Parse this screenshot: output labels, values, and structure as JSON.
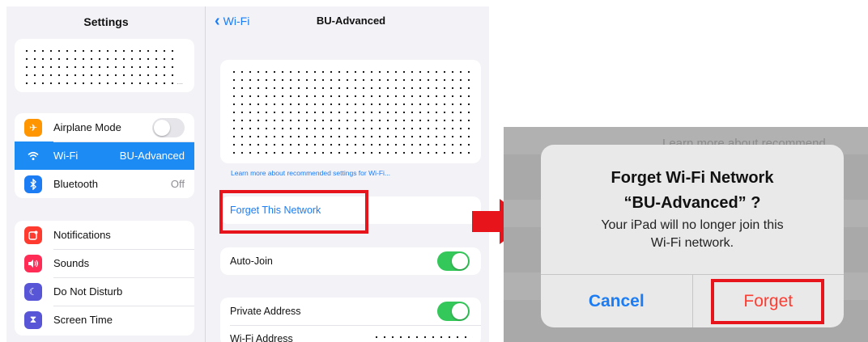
{
  "settings": {
    "title": "Settings",
    "connectivity": [
      {
        "label": "Airplane Mode",
        "icon": "airplane-icon",
        "color": "#ff9500",
        "toggle": "off"
      },
      {
        "label": "Wi-Fi",
        "icon": "wifi-icon",
        "color": "#1c8bf3",
        "value": "BU-Advanced",
        "selected": true
      },
      {
        "label": "Bluetooth",
        "icon": "bluetooth-icon",
        "color": "#1c7cf3",
        "value": "Off"
      }
    ],
    "notifications_group": [
      {
        "label": "Notifications",
        "icon": "notifications-icon",
        "color": "#ff3b30"
      },
      {
        "label": "Sounds",
        "icon": "sounds-icon",
        "color": "#ff2d55"
      },
      {
        "label": "Do Not Disturb",
        "icon": "moon-icon",
        "color": "#5856d6"
      },
      {
        "label": "Screen Time",
        "icon": "hourglass-icon",
        "color": "#5856d6"
      }
    ]
  },
  "network": {
    "back_label": "Wi-Fi",
    "title": "BU-Advanced",
    "learn_more": "Learn more about recommended settings for Wi-Fi...",
    "forget_label": "Forget This Network",
    "auto_join_label": "Auto-Join",
    "auto_join": "on",
    "private_address_label": "Private Address",
    "private_address": "on",
    "wifi_address_label": "Wi-Fi Address"
  },
  "alert": {
    "background_text": "Learn more about recommend",
    "title_line1": "Forget Wi-Fi Network",
    "title_line2": "“BU-Advanced” ?",
    "message_line1": "Your iPad will no longer join this",
    "message_line2": "Wi-Fi network.",
    "cancel_label": "Cancel",
    "forget_label": "Forget"
  },
  "colors": {
    "highlight": "#e8141b",
    "ios_blue": "#1c7cf3",
    "ios_green": "#34c759",
    "ios_red": "#ff3b30"
  }
}
